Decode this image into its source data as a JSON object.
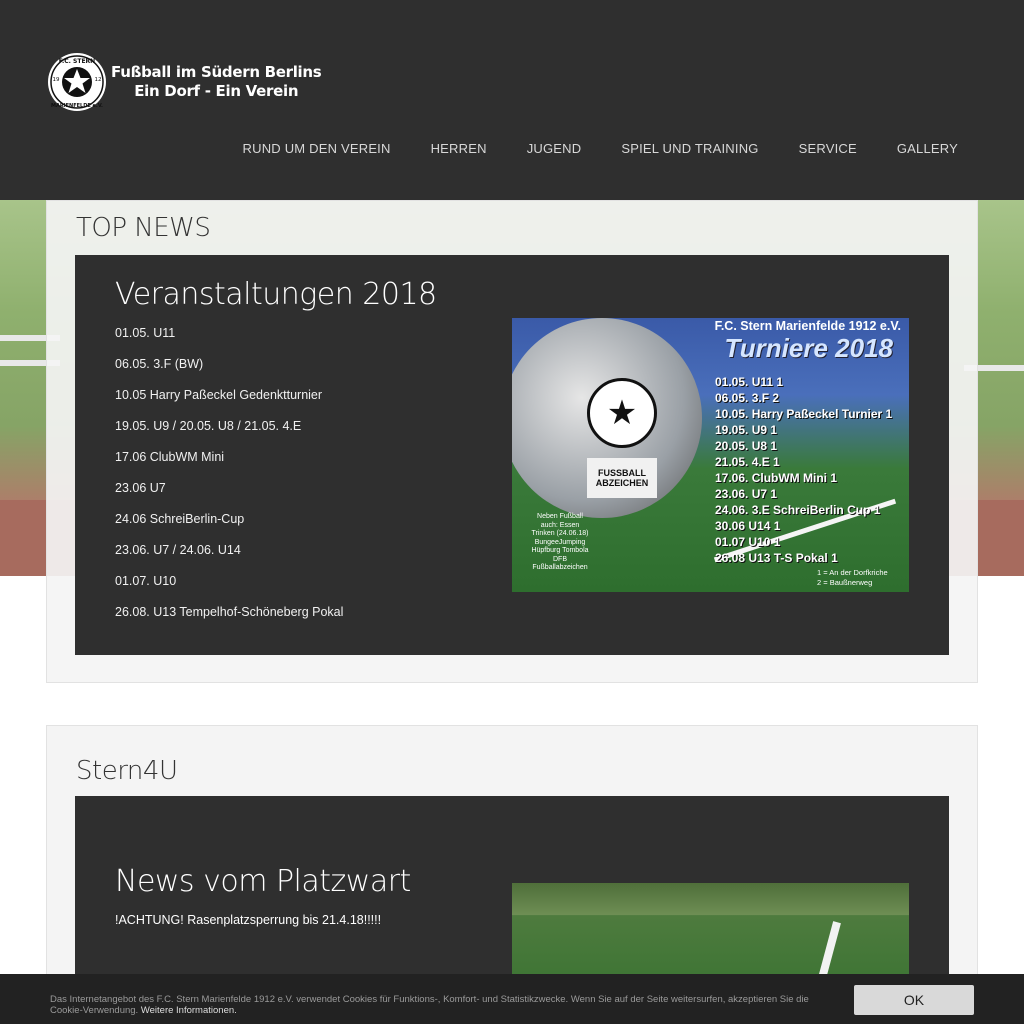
{
  "brand": {
    "badge_top": "F.C. STERN",
    "badge_bottom": "MARIENFELDE e.V.",
    "badge_left": "19",
    "badge_right": "12",
    "line1": "Fußball im Südern Berlins",
    "line2": "Ein Dorf - Ein Verein"
  },
  "nav": [
    "RUND UM DEN VEREIN",
    "HERREN",
    "JUGEND",
    "SPIEL UND TRAINING",
    "SERVICE",
    "GALLERY"
  ],
  "top_news": {
    "section_title": "TOP NEWS",
    "card_title": "Veranstaltungen 2018",
    "events": [
      "01.05. U11",
      "06.05. 3.F (BW)",
      "10.05 Harry Paßeckel Gedenktturnier",
      "19.05. U9 / 20.05. U8 / 21.05. 4.E",
      "17.06 ClubWM Mini",
      "23.06 U7",
      "24.06 SchreiBerlin-Cup",
      "23.06. U7 / 24.06. U14",
      "01.07. U10",
      "26.08. U13 Tempelhof-Schöneberg Pokal"
    ],
    "poster": {
      "title": "F.C. Stern Marienfelde 1912 e.V.",
      "subtitle": "Turniere 2018",
      "list": [
        "01.05. U11 1",
        "06.05. 3.F 2",
        "10.05. Harry Paßeckel Turnier 1",
        "19.05. U9 1",
        "20.05. U8 1",
        "21.05. 4.E 1",
        "17.06. ClubWM Mini 1",
        "23.06. U7 1",
        "24.06. 3.E SchreiBerlin Cup 1",
        "30.06 U14 1",
        "01.07 U10 1",
        "26.08 U13 T-S Pokal 1"
      ],
      "legend1": "1 = An der Dorfkriche",
      "legend2": "2 = Baußnerweg",
      "badge": "FUSSBALL ABZEICHEN",
      "side_text": "Neben Fußball auch: Essen Trinken (24.06.18) BungeeJumping Hüpfburg Tombola DFB Fußballabzeichen"
    }
  },
  "stern4u": {
    "section_title": "Stern4U",
    "card_title": "News vom Platzwart",
    "text": "!ACHTUNG! Rasenplatzsperrung bis 21.4.18!!!!!"
  },
  "cookie": {
    "text": "Das Internetangebot des F.C. Stern Marienfelde 1912 e.V. verwendet Cookies für Funktions-, Komfort- und Statistikzwecke. Wenn Sie auf der Seite weitersurfen, akzeptieren Sie die Cookie-Verwendung.",
    "more": "Weitere Informationen.",
    "button": "OK"
  }
}
